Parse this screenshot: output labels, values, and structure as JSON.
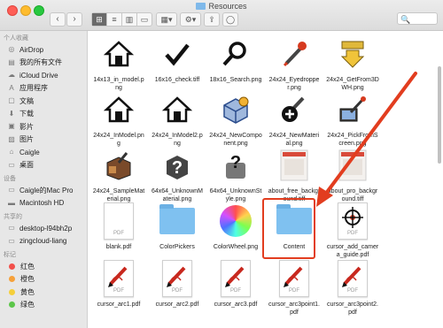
{
  "window": {
    "title": "Resources"
  },
  "toolbar": {
    "back": "‹",
    "forward": "›",
    "view_icon": "⊞",
    "view_list": "≡",
    "view_columns": "▥",
    "view_gallery": "▭",
    "group_by": "▦▾",
    "action": "⚙▾",
    "share": "⇪",
    "tag": "◯",
    "search_placeholder": "🔍"
  },
  "sidebar": {
    "favorites_header": "个人收藏",
    "favorites": [
      {
        "label": "AirDrop",
        "icon": "airdrop-icon",
        "glyph": "◎"
      },
      {
        "label": "我的所有文件",
        "icon": "all-files-icon",
        "glyph": "▤"
      },
      {
        "label": "iCloud Drive",
        "icon": "cloud-icon",
        "glyph": "☁"
      },
      {
        "label": "应用程序",
        "icon": "applications-icon",
        "glyph": "A"
      },
      {
        "label": "文稿",
        "icon": "documents-icon",
        "glyph": "▢"
      },
      {
        "label": "下载",
        "icon": "downloads-icon",
        "glyph": "⬇"
      },
      {
        "label": "影片",
        "icon": "movies-icon",
        "glyph": "▣"
      },
      {
        "label": "图片",
        "icon": "pictures-icon",
        "glyph": "▨"
      },
      {
        "label": "Caigle",
        "icon": "home-icon",
        "glyph": "⌂"
      },
      {
        "label": "桌面",
        "icon": "desktop-icon",
        "glyph": "▭"
      }
    ],
    "devices_header": "设备",
    "devices": [
      {
        "label": "Caigle的Mac Pro",
        "icon": "laptop-icon",
        "glyph": "▭"
      },
      {
        "label": "Macintosh HD",
        "icon": "hard-drive-icon",
        "glyph": "▬"
      }
    ],
    "shared_header": "共享的",
    "shared": [
      {
        "label": "desktop-l94bh2p",
        "icon": "network-computer-icon",
        "glyph": "▭"
      },
      {
        "label": "zingcloud-liang",
        "icon": "network-computer-icon",
        "glyph": "▭"
      }
    ],
    "tags_header": "标记",
    "tags": [
      {
        "label": "红色",
        "color": "#f2504b"
      },
      {
        "label": "橙色",
        "color": "#f6a13a"
      },
      {
        "label": "黄色",
        "color": "#f5cf3a"
      },
      {
        "label": "绿色",
        "color": "#5cc64a"
      }
    ]
  },
  "files": [
    {
      "name": "14x13_in_model.png",
      "icon": "house-icon"
    },
    {
      "name": "16x16_check.tiff",
      "icon": "check-icon"
    },
    {
      "name": "18x16_Search.png",
      "icon": "magnifier-icon"
    },
    {
      "name": "24x24_Eyedropper.png",
      "icon": "eyedropper-icon"
    },
    {
      "name": "24x24_GetFrom3DWH.png",
      "icon": "download-arrow-icon"
    },
    {
      "name": "24x24_InModel.png",
      "icon": "house-icon"
    },
    {
      "name": "24x24_InModel2.png",
      "icon": "house-icon"
    },
    {
      "name": "24x24_NewComponent.png",
      "icon": "component-icon"
    },
    {
      "name": "24x24_NewMaterial.png",
      "icon": "material-icon"
    },
    {
      "name": "24x24_PickFromScreen.png",
      "icon": "picker-icon"
    },
    {
      "name": "24x24_SampleMaterial.png",
      "icon": "sample-material-icon"
    },
    {
      "name": "64x64_UnknownMaterial.png",
      "icon": "unknown-material-icon"
    },
    {
      "name": "64x64_UnknownStyle.png",
      "icon": "unknown-style-icon"
    },
    {
      "name": "about_free_background.tiff",
      "icon": "image-thumbnail-icon"
    },
    {
      "name": "about_pro_background.tiff",
      "icon": "image-thumbnail-icon"
    },
    {
      "name": "blank.pdf",
      "icon": "pdf-icon"
    },
    {
      "name": "ColorPickers",
      "icon": "folder-icon"
    },
    {
      "name": "ColorWheel.png",
      "icon": "color-wheel-icon"
    },
    {
      "name": "Content",
      "icon": "folder-icon"
    },
    {
      "name": "cursor_add_camera_guide.pdf",
      "icon": "crosshair-icon"
    },
    {
      "name": "cursor_arc1.pdf",
      "icon": "pencil-icon"
    },
    {
      "name": "cursor_arc2.pdf",
      "icon": "pencil-icon"
    },
    {
      "name": "cursor_arc3.pdf",
      "icon": "pencil-icon"
    },
    {
      "name": "cursor_arc3point1.pdf",
      "icon": "pencil-icon"
    },
    {
      "name": "cursor_arc3point2.pdf",
      "icon": "pencil-icon"
    }
  ],
  "pdf_label": "PDF",
  "colors": {
    "annotation": "#e23d1f",
    "folder": "#7fc1f0"
  }
}
